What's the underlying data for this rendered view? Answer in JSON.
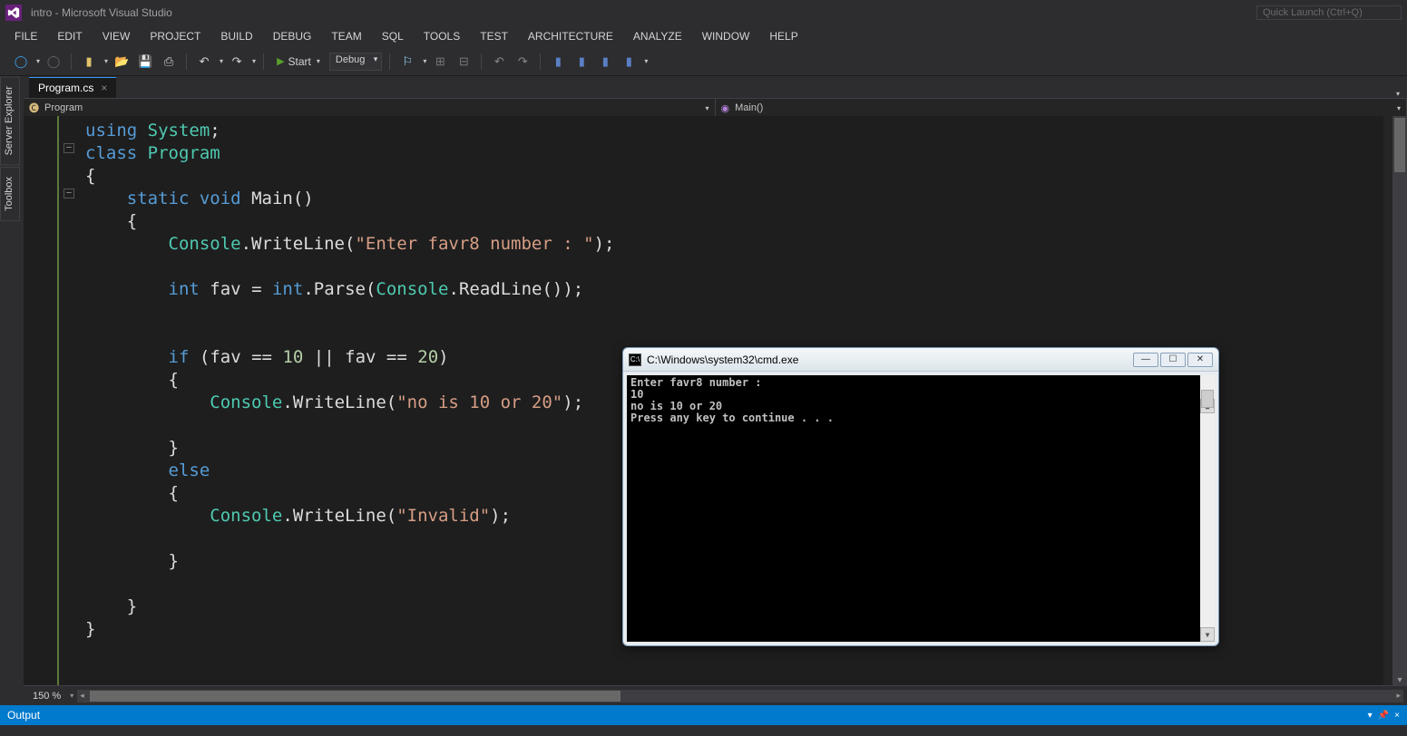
{
  "window": {
    "title": "intro - Microsoft Visual Studio",
    "quick_launch_placeholder": "Quick Launch (Ctrl+Q)"
  },
  "menu": [
    "FILE",
    "EDIT",
    "VIEW",
    "PROJECT",
    "BUILD",
    "DEBUG",
    "TEAM",
    "SQL",
    "TOOLS",
    "TEST",
    "ARCHITECTURE",
    "ANALYZE",
    "WINDOW",
    "HELP"
  ],
  "toolbar": {
    "start_label": "Start",
    "config_label": "Debug"
  },
  "side_tabs": [
    "Server Explorer",
    "Toolbox"
  ],
  "tabs": {
    "active": "Program.cs"
  },
  "navbar": {
    "class": "Program",
    "method": "Main()"
  },
  "zoom": "150 %",
  "output_title": "Output",
  "code": {
    "l1_using": "using",
    "l1_system": "System",
    "l2_class": "class",
    "l2_program": "Program",
    "l4_static": "static",
    "l4_void": "void",
    "l4_main": "Main",
    "l6_console": "Console",
    "l6_wl": "WriteLine",
    "l6_str": "\"Enter favr8 number : \"",
    "l8_int": "int",
    "l8_fav": "fav",
    "l8_intt": "int",
    "l8_parse": "Parse",
    "l8_console": "Console",
    "l8_readline": "ReadLine",
    "l11_if": "if",
    "l11_fav": "fav",
    "l11_10": "10",
    "l11_or": "||",
    "l11_fav2": "fav",
    "l11_20": "20",
    "l13_console": "Console",
    "l13_wl": "WriteLine",
    "l13_str": "\"no is 10 or 20\"",
    "l16_else": "else",
    "l18_console": "Console",
    "l18_wl": "WriteLine",
    "l18_str": "\"Invalid\""
  },
  "console": {
    "title": "C:\\Windows\\system32\\cmd.exe",
    "lines": [
      "Enter favr8 number :",
      "10",
      "no is 10 or 20",
      "Press any key to continue . . ."
    ]
  }
}
